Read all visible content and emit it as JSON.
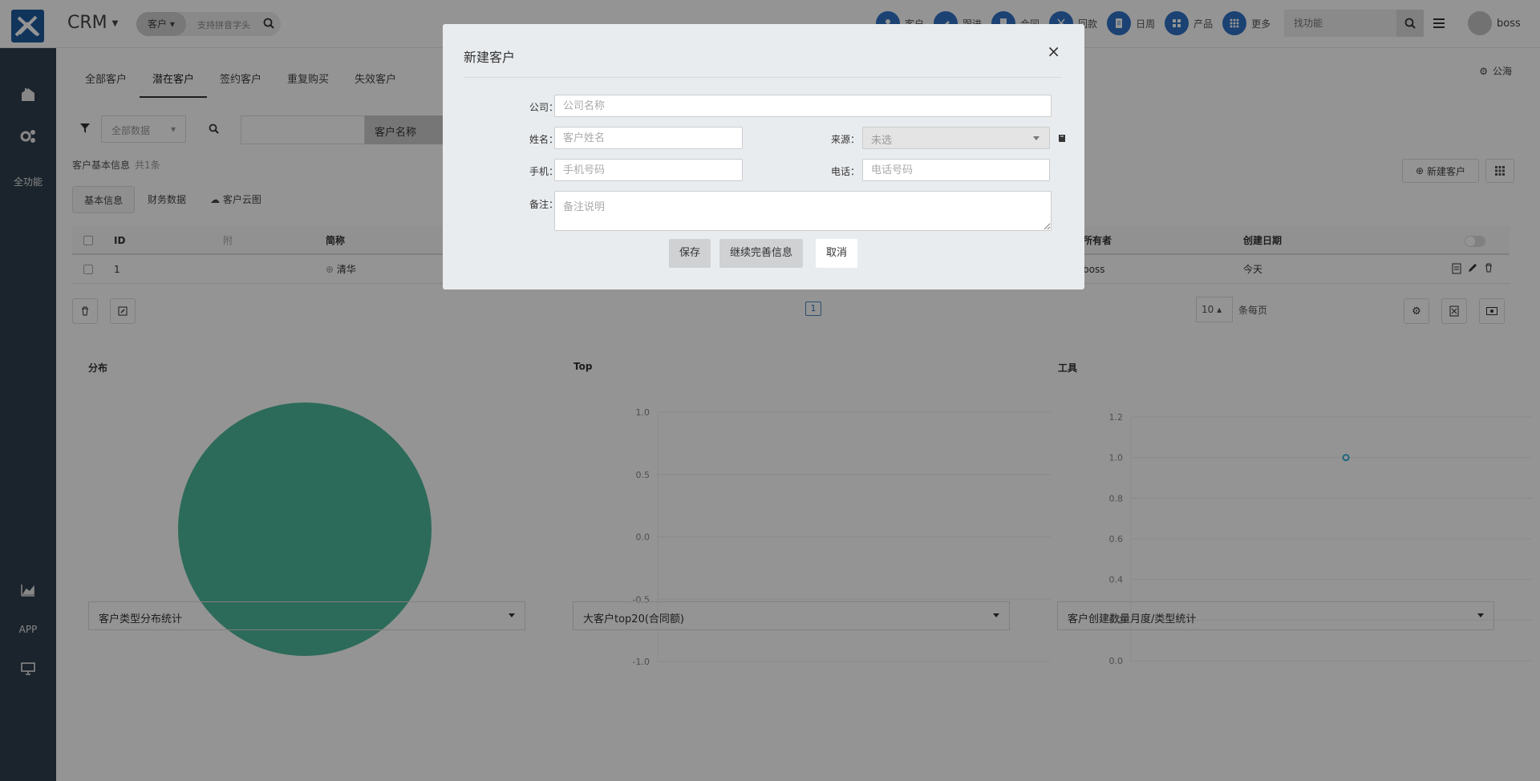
{
  "header": {
    "app_title": "CRM",
    "search_scope": "客户",
    "search_placeholder": "支持拼音字头",
    "shortcuts": [
      {
        "label": "客户",
        "icon": "person-icon"
      },
      {
        "label": "跟进",
        "icon": "pen-icon"
      },
      {
        "label": "合同",
        "icon": "contract-icon"
      },
      {
        "label": "回款",
        "icon": "yen-icon"
      },
      {
        "label": "日周",
        "icon": "report-icon"
      },
      {
        "label": "产品",
        "icon": "grid-icon"
      },
      {
        "label": "更多",
        "icon": "more-icon"
      }
    ],
    "find_placeholder": "找功能",
    "user_name": "boss"
  },
  "sidebar": {
    "all_functions": "全功能",
    "app_label": "APP"
  },
  "tabs": [
    "全部客户",
    "潜在客户",
    "签约客户",
    "重复购买",
    "失效客户"
  ],
  "active_tab": "潜在客户",
  "gonghai": "公海",
  "filters": {
    "scope": "全部数据",
    "field": "客户名称"
  },
  "info": {
    "label": "客户基本信息",
    "count": "共1条"
  },
  "new_customer_button": "新建客户",
  "subtabs": [
    "基本信息",
    "财务数据",
    "客户云图"
  ],
  "table": {
    "columns": [
      "ID",
      "附",
      "简称",
      "所有者",
      "创建日期"
    ],
    "rows": [
      {
        "id": "1",
        "attach": "",
        "short_name": "清华",
        "owner": "boss",
        "created": "今天"
      }
    ]
  },
  "pagination": {
    "current_page": "1",
    "page_size": "10",
    "per_page_label": "条每页"
  },
  "charts": {
    "distribution": {
      "title": "分布",
      "selector": "客户类型分布统计"
    },
    "top": {
      "title": "Top",
      "selector": "大客户top20(合同额)"
    },
    "tools": {
      "title": "工具",
      "selector": "客户创建数量月度/类型统计"
    }
  },
  "chart_data": [
    {
      "type": "pie",
      "title": "分布",
      "slices": [
        {
          "label": "",
          "value": 1,
          "color": "#4db89a"
        }
      ]
    },
    {
      "type": "line",
      "title": "Top",
      "ylim": [
        -1.0,
        1.0
      ],
      "yticks": [
        "1.0",
        "0.5",
        "0.0",
        "-0.5",
        "-1.0"
      ],
      "series": []
    },
    {
      "type": "scatter",
      "title": "工具",
      "ylim": [
        0.0,
        1.2
      ],
      "yticks": [
        "1.2",
        "1.0",
        "0.8",
        "0.6",
        "0.4",
        "0.2",
        "0.0"
      ],
      "points": [
        {
          "x": 0,
          "y": 1.0
        }
      ]
    }
  ],
  "modal": {
    "title": "新建客户",
    "company_label": "公司：",
    "company_placeholder": "公司名称",
    "name_label": "姓名：",
    "name_placeholder": "客户姓名",
    "source_label": "来源：",
    "source_value": "未选",
    "mobile_label": "手机：",
    "mobile_placeholder": "手机号码",
    "phone_label": "电话：",
    "phone_placeholder": "电话号码",
    "note_label": "备注：",
    "note_placeholder": "备注说明",
    "save": "保存",
    "continue": "继续完善信息",
    "cancel": "取消"
  },
  "colors": {
    "sidebar": "#2f3e4d",
    "accent": "#2f73c6",
    "pie": "#4db89a"
  }
}
